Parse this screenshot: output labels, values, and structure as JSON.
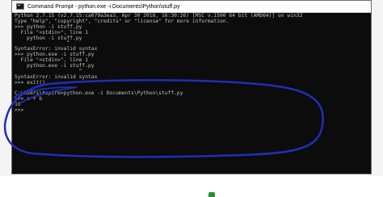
{
  "window": {
    "title": "Command Prompt - python.exe -i Documents\\Python\\stuff.py"
  },
  "console": {
    "lines": [
      "Python 2.7.15 (v2.7.15:ca079a3ea3, Apr 30 2018, 16:30:26) [MSC v.1500 64 bit (AMD64)] on win32",
      "Type \"help\", \"copyright\", \"credits\" or \"license\" for more information.",
      ">>> python -i stuff.py",
      "  File \"<stdin>\", line 1",
      "    python -i stuff.py",
      "                 ^",
      "SyntaxError: invalid syntax",
      ">>> python.exe -i stuff.py",
      "  File \"<stdin>\", line 1",
      "    python.exe -i stuff.py",
      "                     ^",
      "SyntaxError: invalid syntax",
      ">>> exit()",
      "",
      "C:\\Users\\Aspire>python.exe -i Documents\\Python\\stuff.py",
      ">>> a + b",
      "10",
      ">>>"
    ]
  },
  "colors": {
    "console_background": "#0c0c0c",
    "console_text": "#c0c0c0",
    "annotation_stroke": "#1f2fb8"
  }
}
